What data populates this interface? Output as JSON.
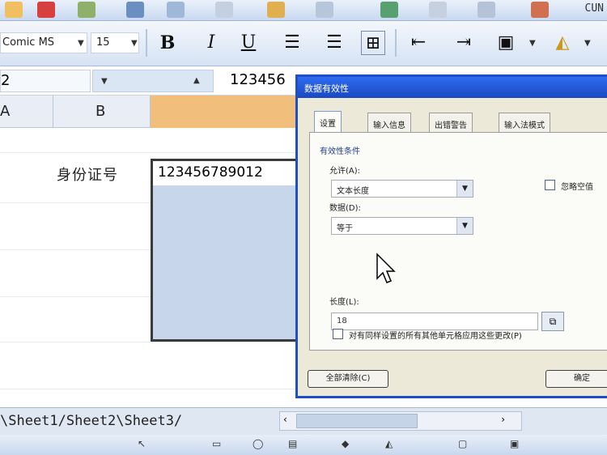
{
  "toolbar": {
    "corner_label": "CUN"
  },
  "format_toolbar": {
    "font_name": "Comic MS",
    "font_size": "15",
    "bold": "B",
    "italic": "I",
    "underline": "U"
  },
  "formula_bar": {
    "name_box": "2",
    "value": "123456"
  },
  "columns": {
    "a": "A",
    "b": "B"
  },
  "sheet": {
    "id_label": "身份证号",
    "id_value": "123456789012"
  },
  "dialog": {
    "title": "数据有效性",
    "tabs": [
      "设置",
      "输入信息",
      "出错警告",
      "输入法模式"
    ],
    "criteria_group": "有效性条件",
    "allow_label": "允许(A):",
    "allow_value": "文本长度",
    "ignore_blank": "忽略空值",
    "data_label": "数据(D):",
    "data_value": "等于",
    "length_label": "长度(L):",
    "length_value": "18",
    "apply_all": "对有同样设置的所有其他单元格应用这些更改(P)",
    "clear_all": "全部清除(C)",
    "ok": "确定"
  },
  "sheet_tabs": {
    "text": "\\Sheet1/Sheet2\\Sheet3/"
  },
  "colors": {
    "dialog_title_bar": "#1f4fc4",
    "selection_fill": "#c7d6ea",
    "column_highlight": "#f2be7c"
  }
}
